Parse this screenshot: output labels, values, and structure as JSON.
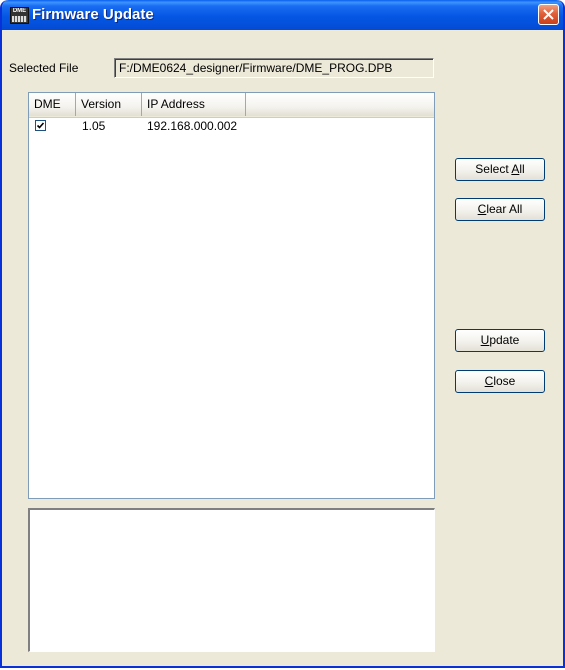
{
  "window": {
    "title": "Firmware Update",
    "icon_label": "DME",
    "close_icon": "close-x-icon"
  },
  "file": {
    "label": "Selected File",
    "value": "F:/DME0624_designer/Firmware/DME_PROG.DPB"
  },
  "list": {
    "columns": [
      "DME",
      "Version",
      "IP Address",
      ""
    ],
    "rows": [
      {
        "checked": true,
        "version": "1.05",
        "ip": "192.168.000.002"
      }
    ]
  },
  "buttons": {
    "select_all": {
      "pre": "Select ",
      "key": "A",
      "post": "ll"
    },
    "clear_all": {
      "pre": "",
      "key": "C",
      "post": "lear All"
    },
    "update": {
      "pre": "",
      "key": "U",
      "post": "pdate"
    },
    "close": {
      "pre": "",
      "key": "C",
      "post": "lose"
    }
  },
  "log": {
    "text": ""
  },
  "colors": {
    "titlebar": "#0451dc",
    "close_button": "#e0603a",
    "window_face": "#ece9d8"
  }
}
